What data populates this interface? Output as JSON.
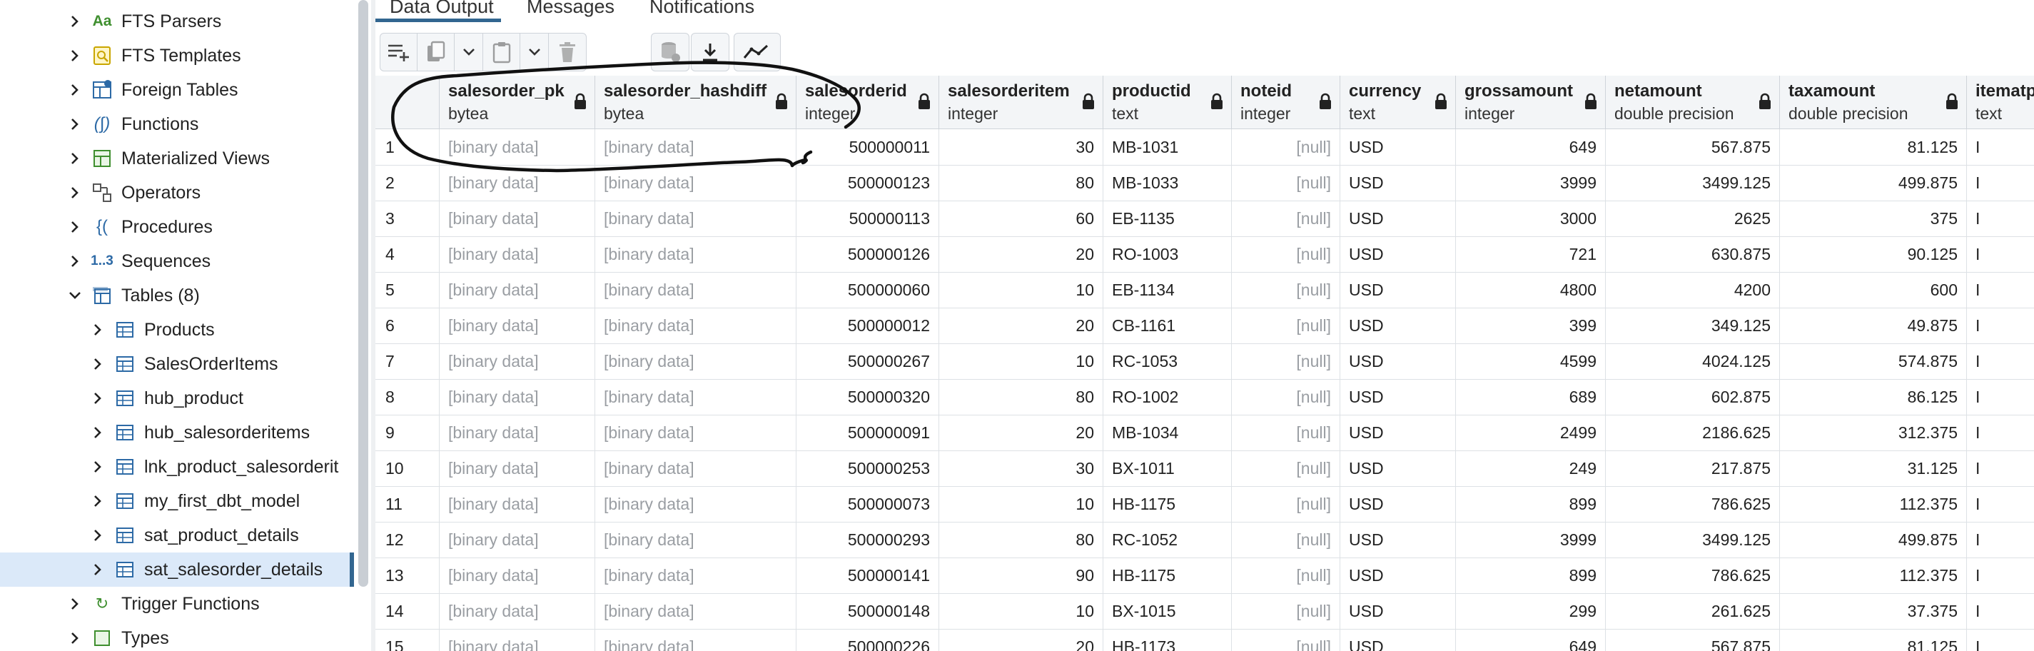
{
  "tree": {
    "items": [
      {
        "label": "FTS Parsers",
        "icon": "fts-parser-icon",
        "level": 0,
        "expanded": false
      },
      {
        "label": "FTS Templates",
        "icon": "fts-template-icon",
        "level": 0,
        "expanded": false
      },
      {
        "label": "Foreign Tables",
        "icon": "foreign-table-icon",
        "level": 0,
        "expanded": false
      },
      {
        "label": "Functions",
        "icon": "function-icon",
        "level": 0,
        "expanded": false
      },
      {
        "label": "Materialized Views",
        "icon": "materialized-view-icon",
        "level": 0,
        "expanded": false
      },
      {
        "label": "Operators",
        "icon": "operator-icon",
        "level": 0,
        "expanded": false
      },
      {
        "label": "Procedures",
        "icon": "procedure-icon",
        "level": 0,
        "expanded": false
      },
      {
        "label": "Sequences",
        "icon": "sequence-icon",
        "level": 0,
        "expanded": false
      },
      {
        "label": "Tables (8)",
        "icon": "tables-icon",
        "level": 0,
        "expanded": true
      },
      {
        "label": "Products",
        "icon": "table-icon",
        "level": 1,
        "expanded": false
      },
      {
        "label": "SalesOrderItems",
        "icon": "table-icon",
        "level": 1,
        "expanded": false
      },
      {
        "label": "hub_product",
        "icon": "table-icon",
        "level": 1,
        "expanded": false
      },
      {
        "label": "hub_salesorderitems",
        "icon": "table-icon",
        "level": 1,
        "expanded": false
      },
      {
        "label": "lnk_product_salesorderit",
        "icon": "table-icon",
        "level": 1,
        "expanded": false
      },
      {
        "label": "my_first_dbt_model",
        "icon": "table-icon",
        "level": 1,
        "expanded": false
      },
      {
        "label": "sat_product_details",
        "icon": "table-icon",
        "level": 1,
        "expanded": false
      },
      {
        "label": "sat_salesorder_details",
        "icon": "table-icon",
        "level": 1,
        "expanded": false,
        "selected": true
      },
      {
        "label": "Trigger Functions",
        "icon": "trigger-function-icon",
        "level": 0,
        "expanded": false
      },
      {
        "label": "Types",
        "icon": "type-icon",
        "level": 0,
        "expanded": false
      }
    ],
    "sequences_glyph": "1..3",
    "fts_parser_glyph": "Aa"
  },
  "tabs": {
    "data_output": "Data Output",
    "messages": "Messages",
    "notifications": "Notifications"
  },
  "toolbar": {
    "buttons": [
      "add-row-icon",
      "copy-icon",
      "chevron-down-icon",
      "paste-icon",
      "chevron-down-icon",
      "delete-icon",
      "save-data-icon",
      "download-icon",
      "graph-icon"
    ]
  },
  "grid": {
    "columns": [
      {
        "name": "salesorder_pk",
        "type": "bytea",
        "align": "left"
      },
      {
        "name": "salesorder_hashdiff",
        "type": "bytea",
        "align": "left"
      },
      {
        "name": "salesorderid",
        "type": "integer",
        "align": "right"
      },
      {
        "name": "salesorderitem",
        "type": "integer",
        "align": "right"
      },
      {
        "name": "productid",
        "type": "text",
        "align": "left"
      },
      {
        "name": "noteid",
        "type": "integer",
        "align": "right"
      },
      {
        "name": "currency",
        "type": "text",
        "align": "left"
      },
      {
        "name": "grossamount",
        "type": "integer",
        "align": "right"
      },
      {
        "name": "netamount",
        "type": "double precision",
        "align": "right"
      },
      {
        "name": "taxamount",
        "type": "double precision",
        "align": "right"
      },
      {
        "name": "itematp",
        "type": "text",
        "align": "left"
      }
    ],
    "rows": [
      [
        "1",
        "[binary data]",
        "[binary data]",
        "500000011",
        "30",
        "MB-1031",
        "[null]",
        "USD",
        "649",
        "567.875",
        "81.125",
        "I"
      ],
      [
        "2",
        "[binary data]",
        "[binary data]",
        "500000123",
        "80",
        "MB-1033",
        "[null]",
        "USD",
        "3999",
        "3499.125",
        "499.875",
        "I"
      ],
      [
        "3",
        "[binary data]",
        "[binary data]",
        "500000113",
        "60",
        "EB-1135",
        "[null]",
        "USD",
        "3000",
        "2625",
        "375",
        "I"
      ],
      [
        "4",
        "[binary data]",
        "[binary data]",
        "500000126",
        "20",
        "RO-1003",
        "[null]",
        "USD",
        "721",
        "630.875",
        "90.125",
        "I"
      ],
      [
        "5",
        "[binary data]",
        "[binary data]",
        "500000060",
        "10",
        "EB-1134",
        "[null]",
        "USD",
        "4800",
        "4200",
        "600",
        "I"
      ],
      [
        "6",
        "[binary data]",
        "[binary data]",
        "500000012",
        "20",
        "CB-1161",
        "[null]",
        "USD",
        "399",
        "349.125",
        "49.875",
        "I"
      ],
      [
        "7",
        "[binary data]",
        "[binary data]",
        "500000267",
        "10",
        "RC-1053",
        "[null]",
        "USD",
        "4599",
        "4024.125",
        "574.875",
        "I"
      ],
      [
        "8",
        "[binary data]",
        "[binary data]",
        "500000320",
        "80",
        "RO-1002",
        "[null]",
        "USD",
        "689",
        "602.875",
        "86.125",
        "I"
      ],
      [
        "9",
        "[binary data]",
        "[binary data]",
        "500000091",
        "20",
        "MB-1034",
        "[null]",
        "USD",
        "2499",
        "2186.625",
        "312.375",
        "I"
      ],
      [
        "10",
        "[binary data]",
        "[binary data]",
        "500000253",
        "30",
        "BX-1011",
        "[null]",
        "USD",
        "249",
        "217.875",
        "31.125",
        "I"
      ],
      [
        "11",
        "[binary data]",
        "[binary data]",
        "500000073",
        "10",
        "HB-1175",
        "[null]",
        "USD",
        "899",
        "786.625",
        "112.375",
        "I"
      ],
      [
        "12",
        "[binary data]",
        "[binary data]",
        "500000293",
        "80",
        "RC-1052",
        "[null]",
        "USD",
        "3999",
        "3499.125",
        "499.875",
        "I"
      ],
      [
        "13",
        "[binary data]",
        "[binary data]",
        "500000141",
        "90",
        "HB-1175",
        "[null]",
        "USD",
        "899",
        "786.625",
        "112.375",
        "I"
      ],
      [
        "14",
        "[binary data]",
        "[binary data]",
        "500000148",
        "10",
        "BX-1015",
        "[null]",
        "USD",
        "299",
        "261.625",
        "37.375",
        "I"
      ],
      [
        "15",
        "[binary data]",
        "[binary data]",
        "500000226",
        "20",
        "HB-1173",
        "[null]",
        "USD",
        "649",
        "567.875",
        "81.125",
        "I"
      ]
    ]
  },
  "colors": {
    "accent": "#326690",
    "selected_row": "#dbe9f9",
    "annotation_ink": "#111111"
  }
}
